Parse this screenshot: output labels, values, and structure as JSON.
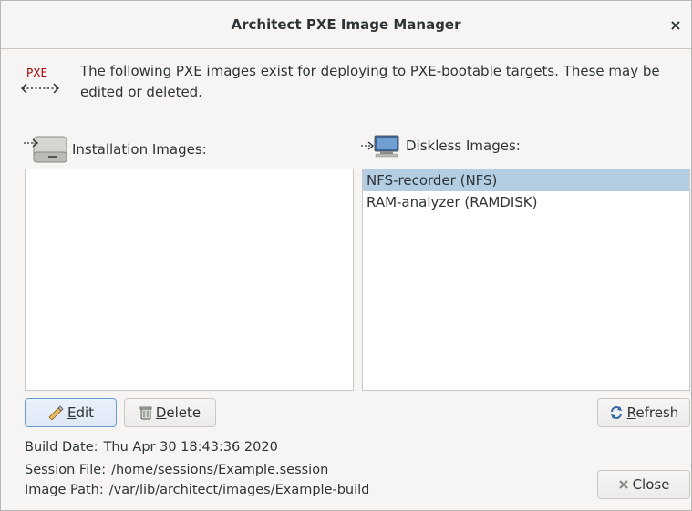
{
  "window": {
    "title": "Architect PXE Image Manager",
    "close_glyph": "×"
  },
  "intro": {
    "icon_label": "PXE",
    "text": "The following PXE images exist for deploying to PXE-bootable targets.  These may be edited or deleted."
  },
  "installation": {
    "label": "Installation Images:",
    "items": []
  },
  "diskless": {
    "label": "Diskless Images:",
    "items": [
      {
        "label": "NFS-recorder (NFS)",
        "selected": true
      },
      {
        "label": "RAM-analyzer (RAMDISK)",
        "selected": false
      }
    ]
  },
  "buttons": {
    "edit": {
      "mnemonic": "E",
      "rest": "dit"
    },
    "delete": {
      "mnemonic": "D",
      "rest": "elete"
    },
    "refresh": {
      "mnemonic": "R",
      "rest": "efresh"
    },
    "close": {
      "label": "Close"
    }
  },
  "info": {
    "build_date": {
      "key": "Build Date:",
      "value": "Thu Apr 30 18:43:36 2020"
    },
    "session_file": {
      "key": "Session File:",
      "value": "/home/sessions/Example.session"
    },
    "image_path": {
      "key": "Image Path:",
      "value": "/var/lib/architect/images/Example-build"
    }
  },
  "colors": {
    "selection": "#b3cde2",
    "window_bg": "#f6f5f4",
    "pxe_red": "#a40000"
  }
}
